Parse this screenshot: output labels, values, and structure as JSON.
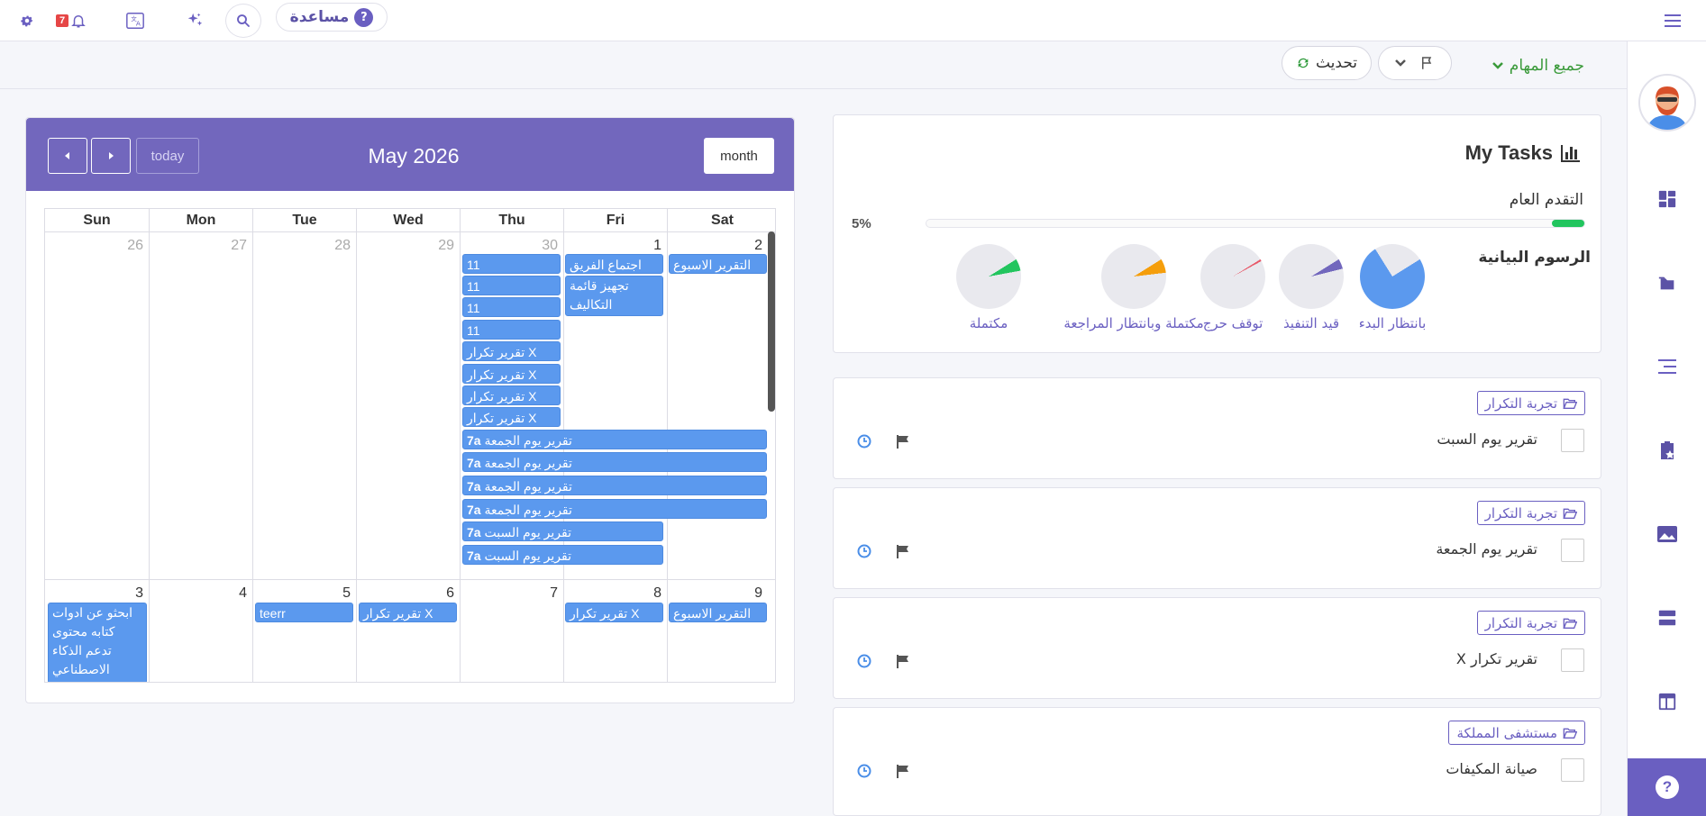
{
  "topbar": {
    "notif_count": "7",
    "help_label": "مساعدة"
  },
  "filter": {
    "all_tasks": "جميع المهام",
    "refresh": "تحديث"
  },
  "calendar": {
    "title": "May 2026",
    "today_label": "today",
    "month_label": "month",
    "dow": [
      "Sun",
      "Mon",
      "Tue",
      "Wed",
      "Thu",
      "Fri",
      "Sat"
    ],
    "week1_days": [
      "26",
      "27",
      "28",
      "29",
      "30",
      "1",
      "2"
    ],
    "week2_days": [
      "3",
      "4",
      "5",
      "6",
      "7",
      "8",
      "9"
    ],
    "events": {
      "thu_a": "11",
      "thu_b": "11",
      "thu_c": "11",
      "thu_d": "11",
      "thu_x1": "X تقرير تكرار",
      "thu_x2": "X تقرير تكرار",
      "thu_x3": "X تقرير تكرار",
      "thu_x4": "X تقرير تكرار",
      "fri_meeting": "اجتماع الفريق",
      "fri_cost": "تجهيز قائمة التكاليف",
      "sat_weekly": "التقرير الاسبوع",
      "friday_time": "7a",
      "friday_report": "تقرير يوم الجمعة",
      "saturday_report": "تقرير يوم السبت",
      "sun3": "ابحثو عن ادوات كتابه محتوى تدعم الذكاء الاصطناعي",
      "tue5": "teerr",
      "wed6": "X تقرير تكرار",
      "fri8": "X تقرير تكرار",
      "sat9": "التقرير الاسبوع"
    }
  },
  "my_tasks": {
    "title": "My Tasks",
    "progress_label": "التقدم العام",
    "progress_pct": "5%",
    "progress_value": 0.05,
    "charts_title": "الرسوم البيانية",
    "pies": [
      {
        "label": "بانتظار البدء",
        "value": 0.75,
        "color": "#5b99ee"
      },
      {
        "label": "قيد التنفيذ",
        "value": 0.05,
        "color": "#7267bd"
      },
      {
        "label": "توقف حرج",
        "value": 0.01,
        "color": "#e85a6a"
      },
      {
        "label": "مكتملة وبانتظار المراجعة",
        "value": 0.07,
        "color": "#f59e0b"
      },
      {
        "label": "مكتملة",
        "value": 0.06,
        "color": "#22c55e"
      }
    ]
  },
  "tasks": [
    {
      "folder": "تجربة التكرار",
      "title": "تقرير يوم السبت"
    },
    {
      "folder": "تجربة التكرار",
      "title": "تقرير يوم الجمعة"
    },
    {
      "folder": "تجربة التكرار",
      "title": "تقرير تكرار X"
    },
    {
      "folder": "مستشفى المملكة",
      "title": "صيانة المكيفات"
    }
  ],
  "colors": {
    "accent": "#7267bd",
    "event": "#5b99ee",
    "success": "#22c55e"
  }
}
